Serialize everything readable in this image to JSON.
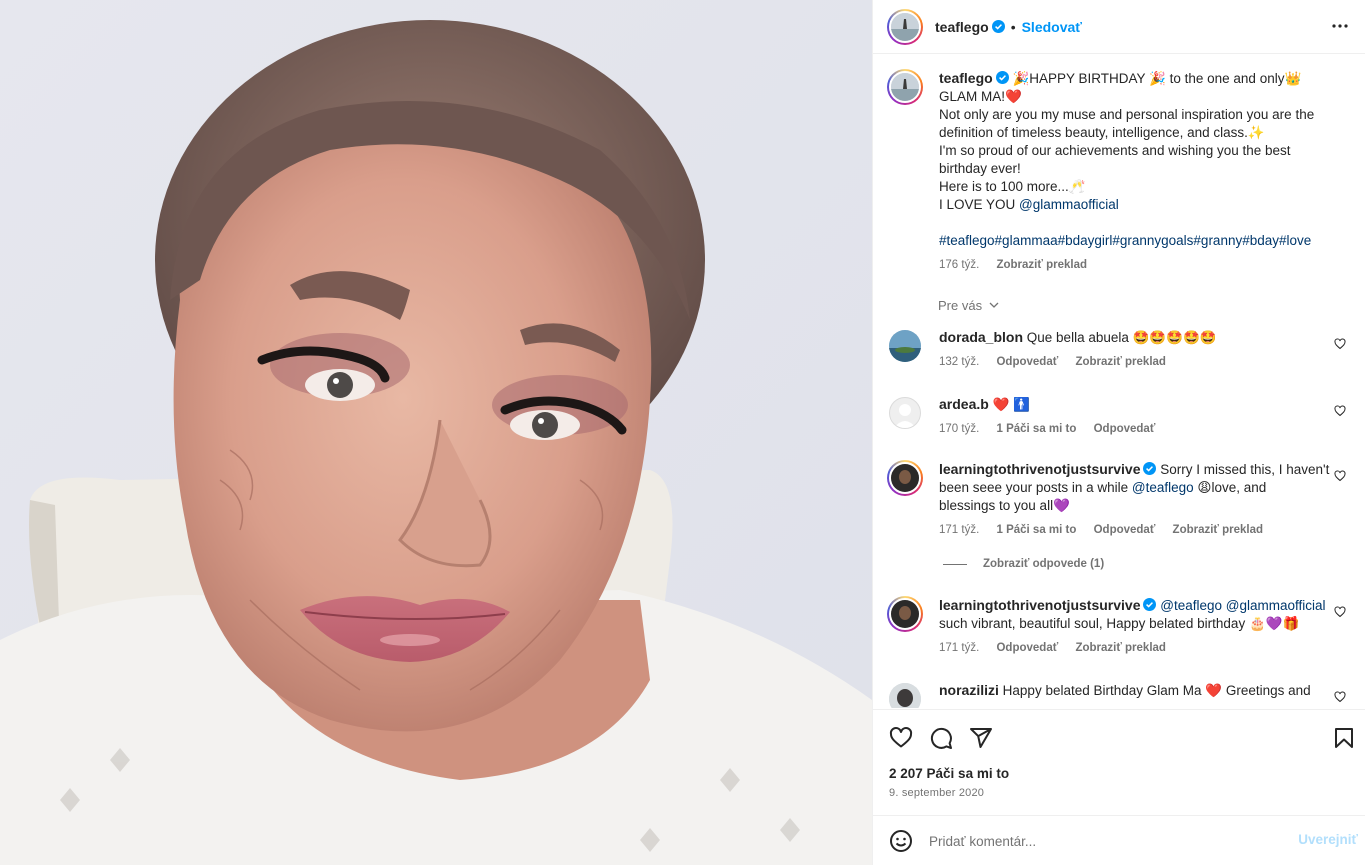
{
  "header": {
    "username": "teaflego",
    "dot": "•",
    "follow_label": "Sledovať"
  },
  "caption": {
    "username": "teaflego",
    "lines": [
      "🎉HAPPY BIRTHDAY 🎉 to the one and only👑",
      "GLAM MA!❤️",
      "Not only are you my muse and personal inspiration you are the",
      "definition of timeless beauty, intelligence, and class.✨",
      "I'm so proud of our achievements and wishing you the best",
      "birthday ever!",
      "Here is to 100 more...🥂",
      "I LOVE YOU "
    ],
    "mention": "@glammaofficial",
    "hashtags": "#teaflego#glammaa#bdaygirl#grannygoals#granny#bday#love",
    "time": "176 týž.",
    "translate": "Zobraziť preklad"
  },
  "more_label": "Pre vás",
  "comments": [
    {
      "username": "dorada_blon",
      "text": "Que bella abuela 🤩🤩🤩🤩🤩",
      "time": "132 týž.",
      "reply": "Odpovedať",
      "translate": "Zobraziť preklad"
    },
    {
      "username": "ardea.b",
      "text": "❤️ 🚹",
      "time": "170 týž.",
      "likes": "1 Páči sa mi to",
      "reply": "Odpovedať"
    },
    {
      "username": "learningtothrivenotjustsurvive",
      "text_a": "Sorry I missed this, I haven't",
      "text_b": "been seee your posts in a while ",
      "mention": "@teaflego",
      "text_c": " 😩love, and",
      "text_d": "blessings to you all💜",
      "time": "171 týž.",
      "likes": "1 Páči sa mi to",
      "reply": "Odpovedať",
      "translate": "Zobraziť preklad"
    },
    {
      "username": "learningtothrivenotjustsurvive",
      "mentions": "@teaflego @glammaofficial",
      "text": "such vibrant, beautiful soul, Happy belated birthday 🎂💜🎁",
      "time": "171 týž.",
      "reply": "Odpovedať",
      "translate": "Zobraziť preklad"
    },
    {
      "username": "norazilizi",
      "text": "Happy belated Birthday Glam Ma ❤️ Greetings and"
    }
  ],
  "view_replies": "Zobraziť odpovede (1)",
  "likes_count": "2 207 Páči sa mi to",
  "post_date": "9. september 2020",
  "comment_box": {
    "placeholder": "Pridať komentár...",
    "post_label": "Uverejniť"
  },
  "colors": {
    "accent": "#0095f6",
    "text": "#262626",
    "muted": "#737373",
    "like_red": "#ed4956"
  },
  "icons": [
    "more-icon",
    "verified-icon",
    "heart-icon",
    "comment-icon",
    "share-icon",
    "bookmark-icon",
    "emoji-icon"
  ]
}
